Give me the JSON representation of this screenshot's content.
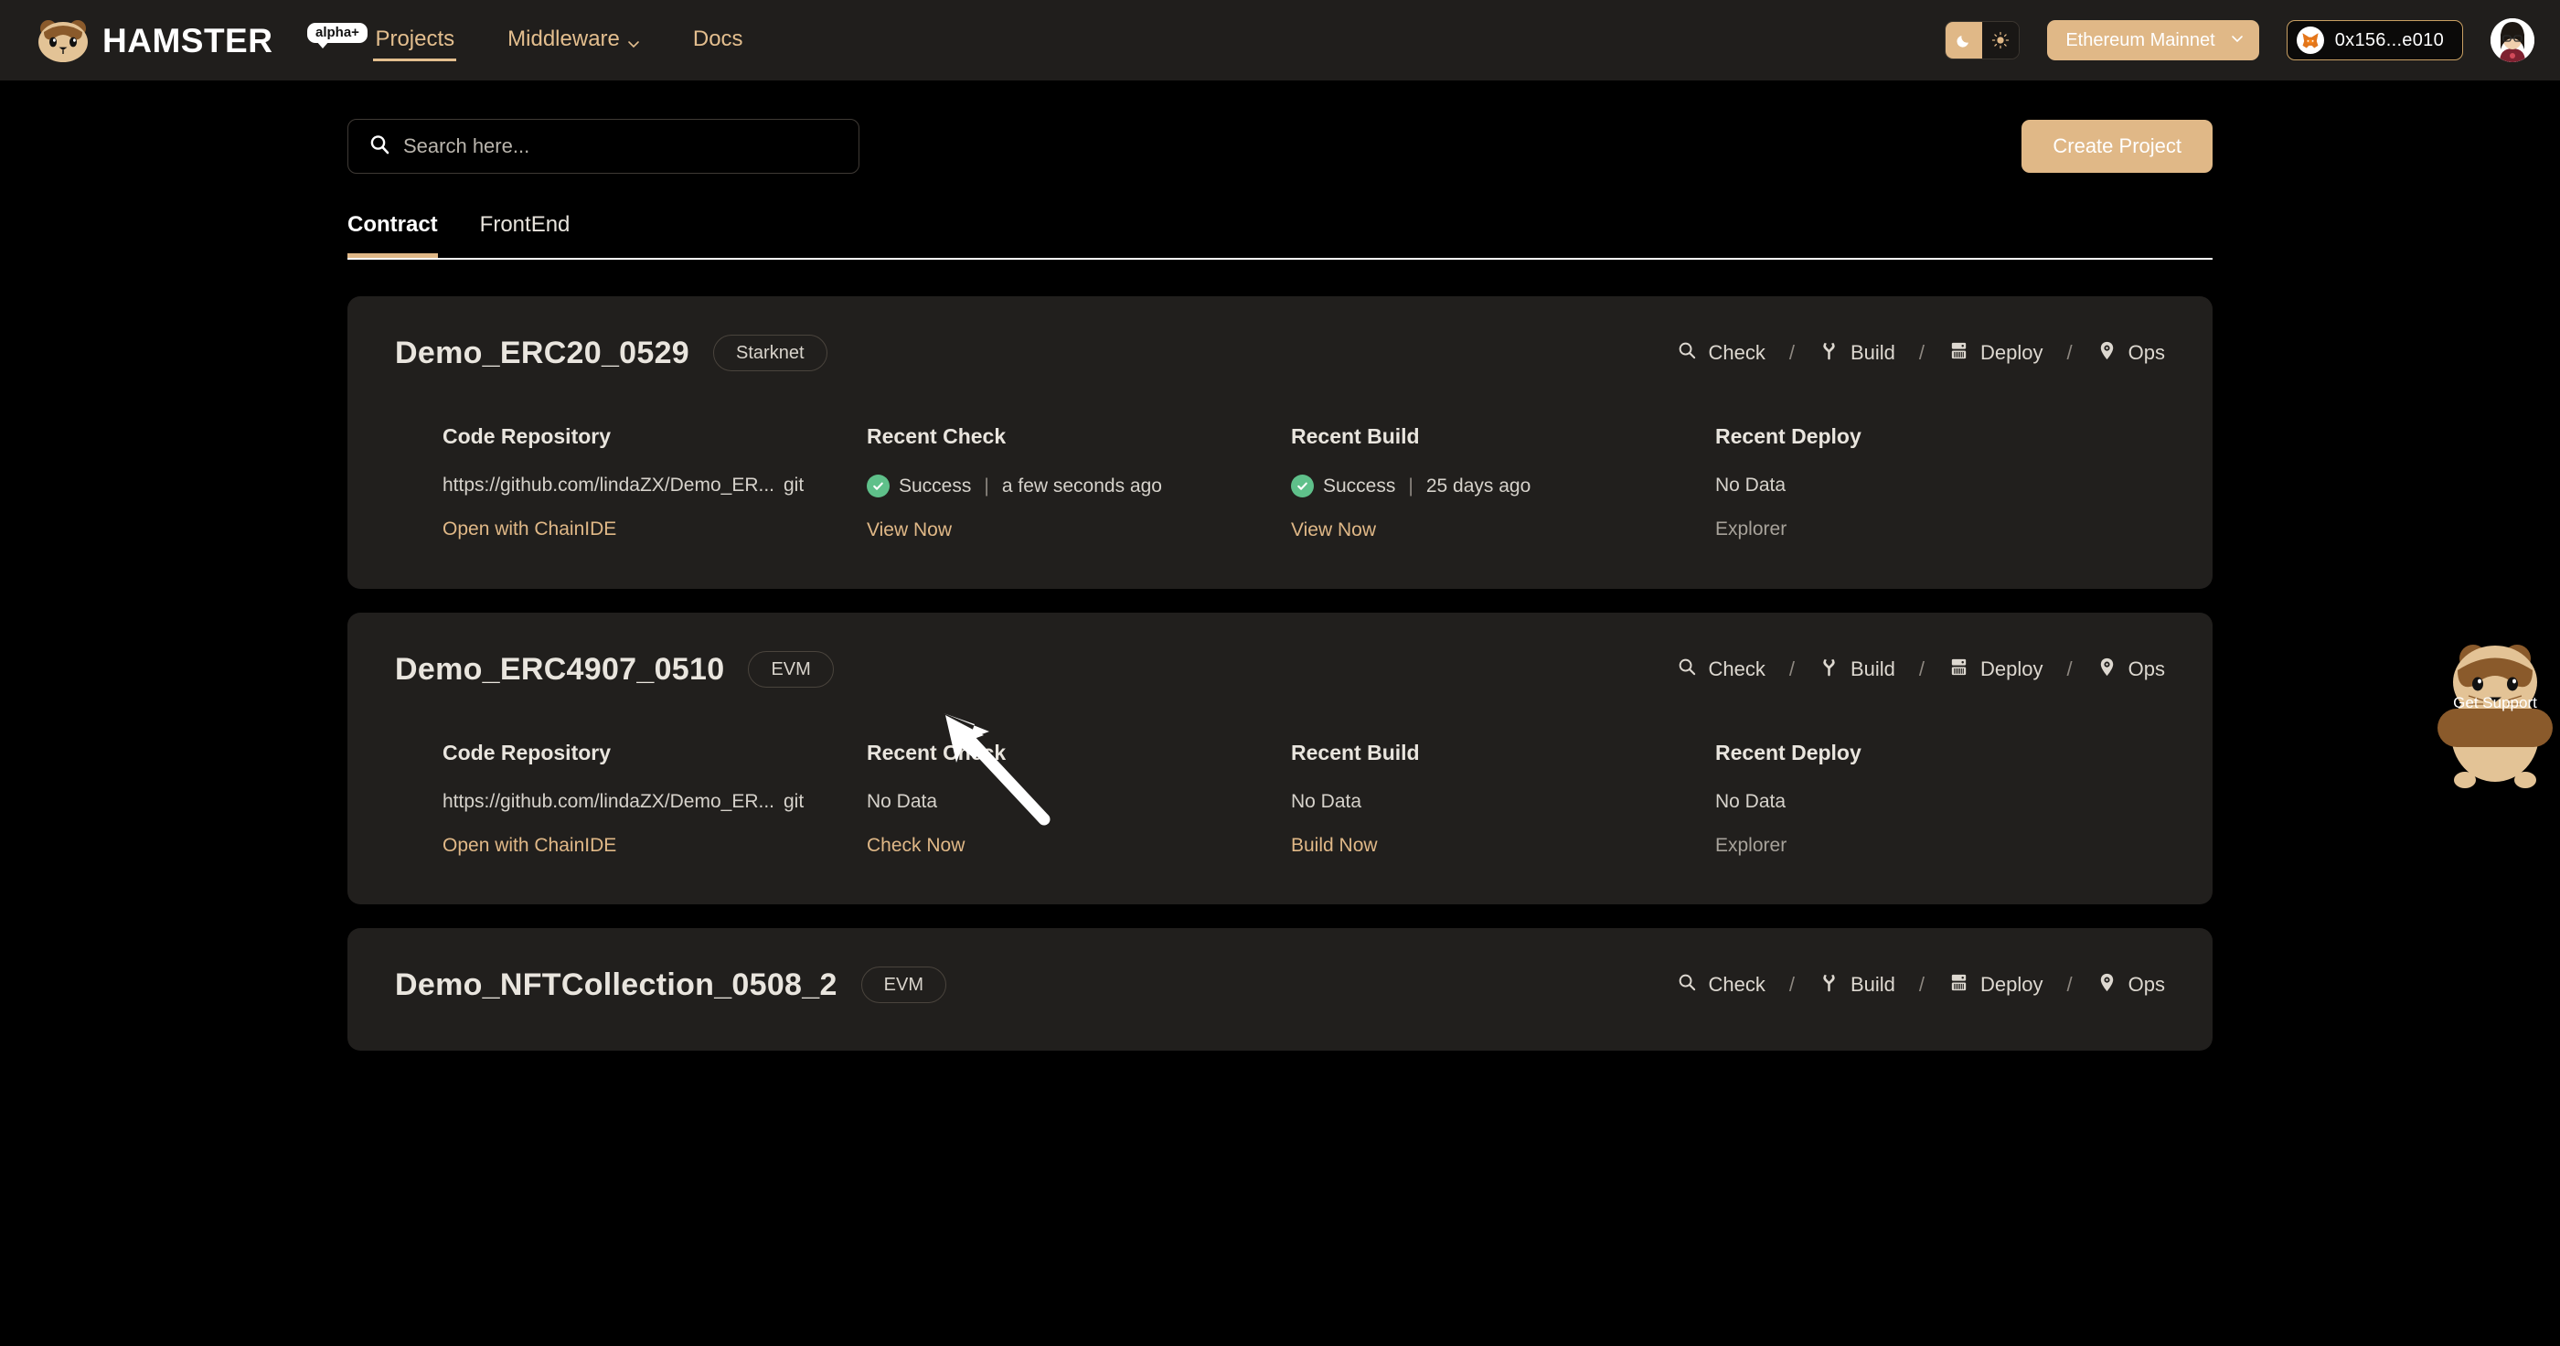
{
  "header": {
    "brand_name": "HAMSTER",
    "brand_badge": "alpha+",
    "nav": [
      {
        "label": "Projects",
        "icon": "",
        "active": true
      },
      {
        "label": "Middleware",
        "icon": "chevron-down-icon",
        "active": false
      },
      {
        "label": "Docs",
        "icon": "",
        "active": false
      }
    ],
    "theme": {
      "dark_icon": "moon-icon",
      "light_icon": "sun-icon",
      "active": "dark"
    },
    "network": {
      "label": "Ethereum Mainnet",
      "caret": "chevron-down-icon"
    },
    "wallet": {
      "icon": "metamask-fox-icon",
      "address": "0x156...e010"
    },
    "avatar": "user-avatar"
  },
  "toolbar": {
    "search_placeholder": "Search here...",
    "search_value": "",
    "search_icon": "search-icon",
    "create_label": "Create Project"
  },
  "tabs": [
    {
      "label": "Contract",
      "active": true
    },
    {
      "label": "FrontEnd",
      "active": false
    }
  ],
  "column_headers": {
    "repo": "Code Repository",
    "check": "Recent Check",
    "build": "Recent Build",
    "deploy": "Recent Deploy"
  },
  "actions": [
    {
      "label": "Check",
      "icon": "magnifier-icon"
    },
    {
      "label": "Build",
      "icon": "hammer-icon"
    },
    {
      "label": "Deploy",
      "icon": "server-icon"
    },
    {
      "label": "Ops",
      "icon": "ops-pin-icon"
    }
  ],
  "action_separator": "/",
  "projects": [
    {
      "name": "Demo_ERC20_0529",
      "chain": "Starknet",
      "repo": {
        "url": "https://github.com/lindaZX/Demo_ER...",
        "tag": "git",
        "link": "Open with ChainIDE"
      },
      "check": {
        "status": "Success",
        "status_icon": "check-circle-icon",
        "time": "a few seconds ago",
        "link": "View Now",
        "link_muted": false
      },
      "build": {
        "status": "Success",
        "status_icon": "check-circle-icon",
        "time": "25 days ago",
        "link": "View Now",
        "link_muted": false
      },
      "deploy": {
        "value": "No Data",
        "link": "Explorer",
        "link_muted": true
      }
    },
    {
      "name": "Demo_ERC4907_0510",
      "chain": "EVM",
      "repo": {
        "url": "https://github.com/lindaZX/Demo_ER...",
        "tag": "git",
        "link": "Open with ChainIDE"
      },
      "check": {
        "status": "",
        "status_icon": "",
        "time": "",
        "value": "No Data",
        "link": "Check Now",
        "link_muted": false
      },
      "build": {
        "status": "",
        "status_icon": "",
        "time": "",
        "value": "No Data",
        "link": "Build Now",
        "link_muted": false
      },
      "deploy": {
        "value": "No Data",
        "link": "Explorer",
        "link_muted": true
      }
    },
    {
      "name": "Demo_NFTCollection_0508_2",
      "chain": "EVM"
    }
  ],
  "support": {
    "label": "Get Support",
    "icon": "hamster-mascot-icon"
  },
  "colors": {
    "page_bg": "#000000",
    "card_bg": "#211f1d",
    "header_bg": "#201e1c",
    "accent": "#e0b887",
    "accent_text": "#e3be8e",
    "success": "#5fc08a",
    "text": "#e9e5de",
    "muted": "#a7a29a"
  }
}
